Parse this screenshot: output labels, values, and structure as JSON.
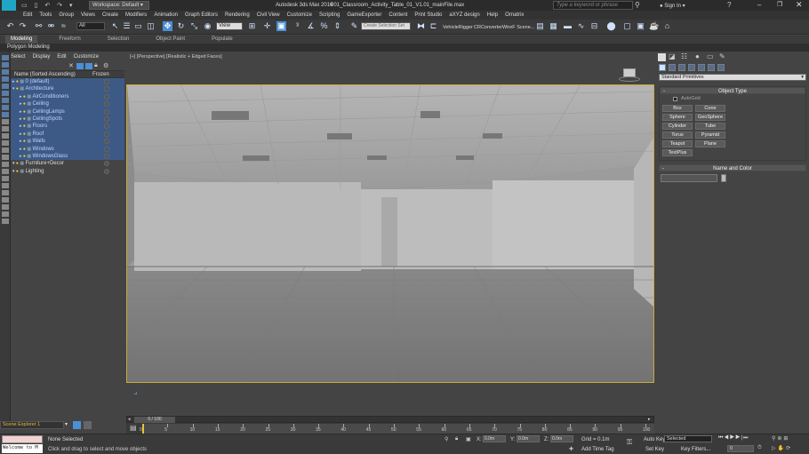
{
  "title_bar": {
    "app_title": "Autodesk 3ds Max 2016",
    "file_title": "001_Classroom_Activity_Table_01_V1.01_mainFile.max",
    "workspace": "Workspace: Default",
    "search_placeholder": "Type a keyword or phrase",
    "sign_in": "Sign In",
    "max_logo": "MAX"
  },
  "menu": [
    "Edit",
    "Tools",
    "Group",
    "Views",
    "Create",
    "Modifiers",
    "Animation",
    "Graph Editors",
    "Rendering",
    "Civil View",
    "Customize",
    "Scripting",
    "GameExporter",
    "Content",
    "Print Studio",
    "aXYZ design",
    "Help",
    "Ornatrix"
  ],
  "toolbar": {
    "selection_filter": "All",
    "reference_coord": "View",
    "named_selection": "Create Selection Set",
    "plugins": [
      "VehicleRigger",
      "CRConverter",
      "WireF Scene..."
    ]
  },
  "ribbon_tabs": [
    "Modeling",
    "Freeform",
    "Selection",
    "Object Paint",
    "Populate"
  ],
  "ribbon_sub": "Polygon Modeling",
  "explorer": {
    "menu": [
      "Select",
      "Display",
      "Edit",
      "Customize"
    ],
    "col_name": "Name (Sorted Ascending)",
    "col_frozen": "Frozen",
    "rows": [
      {
        "label": "0 (default)",
        "level": 1,
        "sel": true
      },
      {
        "label": "Architecture",
        "level": 1,
        "sel": true
      },
      {
        "label": "AirConditioners",
        "level": 2,
        "sel": true
      },
      {
        "label": "Ceiling",
        "level": 2,
        "sel": true
      },
      {
        "label": "CeilingLamps",
        "level": 2,
        "sel": true
      },
      {
        "label": "CeilingSpots",
        "level": 2,
        "sel": true
      },
      {
        "label": "Floors",
        "level": 2,
        "sel": true
      },
      {
        "label": "Roof",
        "level": 2,
        "sel": true
      },
      {
        "label": "Walls",
        "level": 2,
        "sel": true
      },
      {
        "label": "Windows",
        "level": 2,
        "sel": true
      },
      {
        "label": "WindowsGlass",
        "level": 2,
        "sel": true
      },
      {
        "label": "Furniture+Decor",
        "level": 1,
        "sel": false
      },
      {
        "label": "Lighting",
        "level": 1,
        "sel": false
      }
    ],
    "footer_label": "Scene Explorer 1"
  },
  "viewport": {
    "label": "[+] [Perspective] [Realistic + Edged Faces]"
  },
  "command_panel": {
    "category": "Standard Primitives",
    "object_type_header": "Object Type",
    "autogrid": "AutoGrid",
    "buttons": [
      "Box",
      "Cone",
      "Sphere",
      "GeoSphere",
      "Cylinder",
      "Tube",
      "Torus",
      "Pyramid",
      "Teapot",
      "Plane",
      "TextPlus"
    ],
    "name_color_header": "Name and Color"
  },
  "timeline": {
    "frame_display": "0 / 100",
    "ticks": [
      "0",
      "5",
      "10",
      "15",
      "20",
      "25",
      "30",
      "35",
      "40",
      "45",
      "50",
      "55",
      "60",
      "65",
      "70",
      "75",
      "80",
      "85",
      "90",
      "95",
      "100"
    ]
  },
  "status": {
    "maxscript_text": "Welcome to M",
    "selection_text": "None Selected",
    "prompt_text": "Click and drag to select and move objects",
    "x_label": "X:",
    "x_value": "0.0m",
    "y_label": "Y:",
    "y_value": "0.0m",
    "z_label": "Z:",
    "z_value": "0.0m",
    "grid": "Grid = 0.1m",
    "add_time_tag": "Add Time Tag",
    "auto_key": "Auto Key",
    "set_key": "Set Key",
    "key_mode": "Selected",
    "key_filters": "Key Filters...",
    "frame_field": "0"
  }
}
